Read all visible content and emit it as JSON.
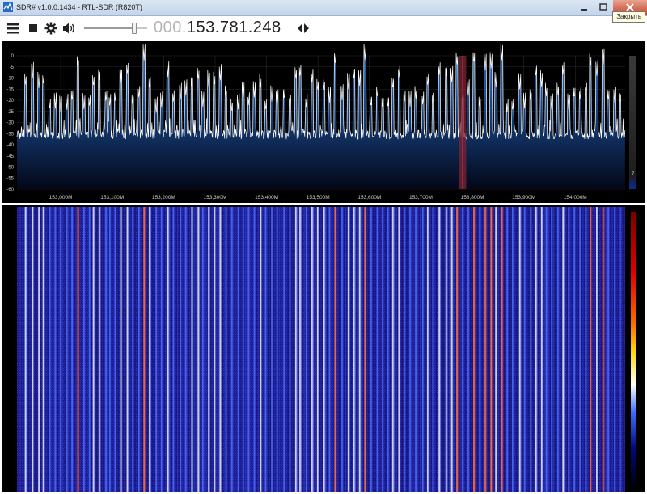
{
  "window": {
    "title": "SDR# v1.0.0.1434 - RTL-SDR (R820T)",
    "close_tooltip": "Закрыть",
    "icons": [
      "app-icon",
      "minimize-icon",
      "maximize-icon",
      "close-icon"
    ]
  },
  "toolbar": {
    "icons": [
      "menu-icon",
      "stop-icon",
      "gear-icon",
      "speaker-icon"
    ],
    "volume_level": 0.82,
    "frequency_dim": "000.",
    "frequency_main": "153.781.248",
    "tune_icon": "tune-arrows-icon"
  },
  "spectrum": {
    "y_ticks": [
      "0",
      "-5",
      "-10",
      "-15",
      "-20",
      "-25",
      "-30",
      "-35",
      "-40",
      "-45",
      "-50",
      "-55",
      "-60"
    ],
    "x_ticks": [
      "153,000M",
      "153,100M",
      "153,200M",
      "153,300M",
      "153,400M",
      "153,500M",
      "153,600M",
      "153,700M",
      "153,800M",
      "153,900M",
      "154,000M"
    ],
    "contrast_value": "7",
    "tuned_frequency_mhz": 153.781,
    "colors": {
      "background": "#000000",
      "fill_top": "#1e5fa7",
      "fill_bottom": "#040a24",
      "trace": "#ffffff",
      "marker": "#8a2a3a"
    }
  },
  "waterfall": {
    "colors": {
      "background": "#1a1a8c",
      "gradient": [
        "#c00000",
        "#ff4000",
        "#ffd000",
        "#ffffff",
        "#3a6cff",
        "#000080",
        "#000000"
      ]
    }
  }
}
